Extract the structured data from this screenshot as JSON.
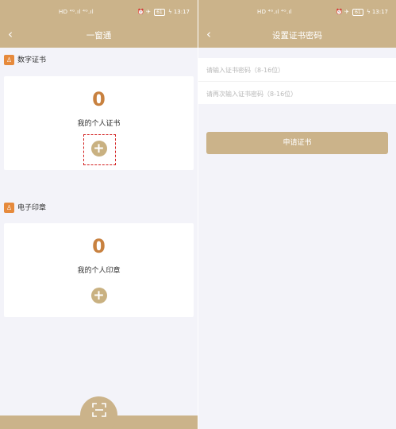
{
  "status_bar": {
    "network": "HD ⁴ᴳ.ıl ⁴ᴳ.ıl",
    "icons": "⏰ ✈",
    "battery": "61",
    "time": "13:17"
  },
  "left": {
    "header": {
      "back_icon": "‹",
      "title": "一窗通"
    },
    "certificate_section": {
      "icon": "♙",
      "title": "数字证书",
      "count": "0",
      "label": "我的个人证书",
      "add_icon": "+"
    },
    "seal_section": {
      "icon": "♙",
      "title": "电子印章",
      "count": "0",
      "label": "我的个人印章",
      "add_icon": "+"
    },
    "scan_button_icon": "scan-icon"
  },
  "right": {
    "header": {
      "back_icon": "‹",
      "title": "设置证书密码"
    },
    "password_placeholder": "请输入证书密码（8-16位）",
    "confirm_placeholder": "请再次输入证书密码（8-16位）",
    "password_value": "",
    "confirm_value": "",
    "apply_label": "申请证书"
  },
  "colors": {
    "header": "#cbb38a",
    "accent_number": "#c8813f",
    "background": "#f3f3f9",
    "section_icon": "#e68a3c",
    "highlight": "#d21d1d"
  }
}
